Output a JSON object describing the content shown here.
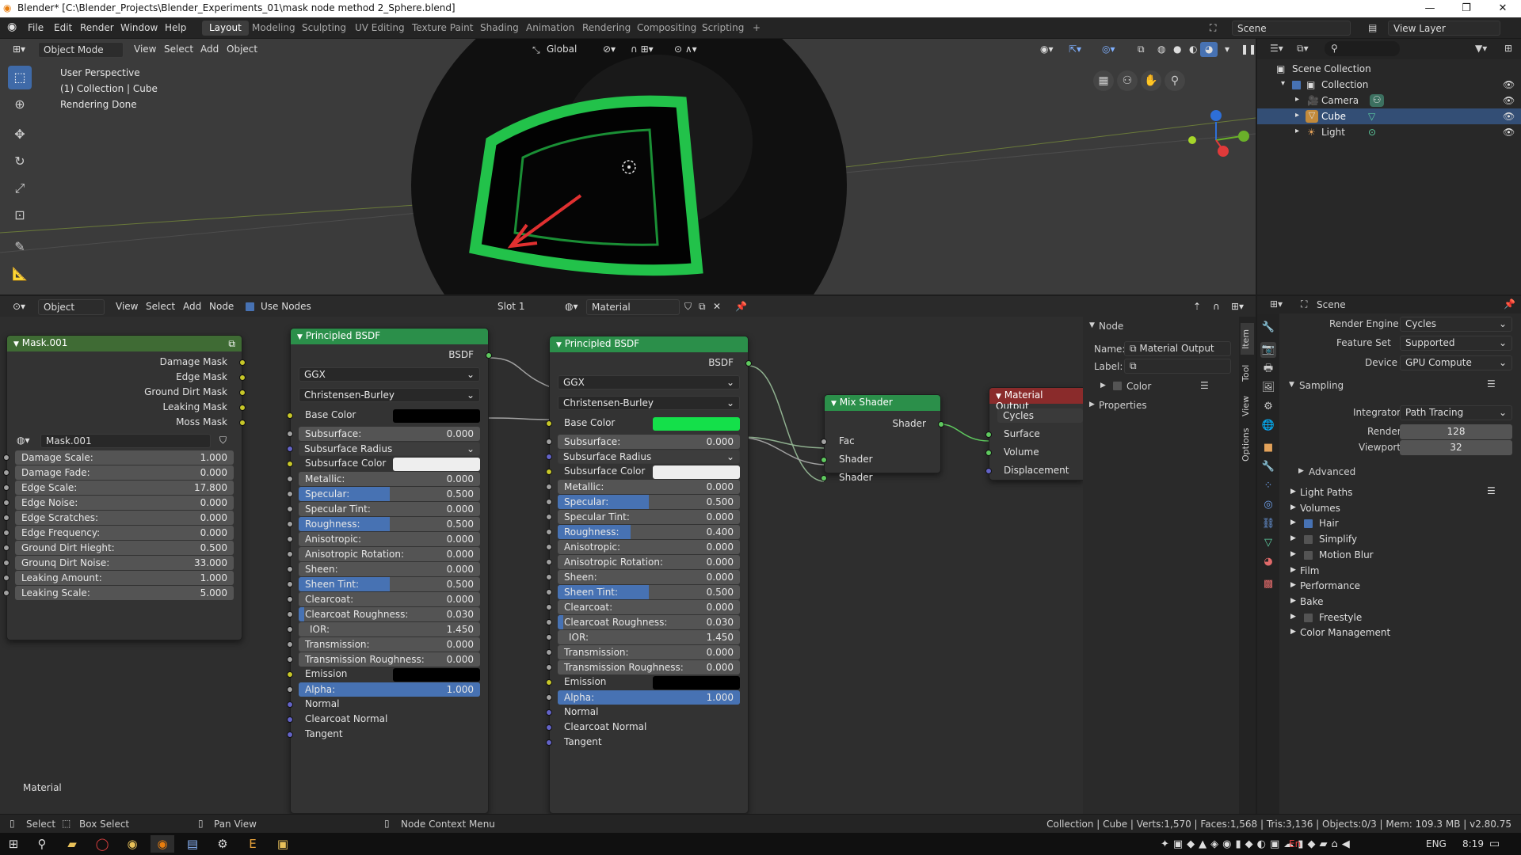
{
  "window": {
    "title": "Blender* [C:\\Blender_Projects\\Blender_Experiments_01\\mask node method 2_Sphere.blend]",
    "minimize": "—",
    "maximize": "❐",
    "close": "✕"
  },
  "topbar": {
    "menus": [
      "File",
      "Edit",
      "Render",
      "Window",
      "Help"
    ],
    "workspaces": [
      "Layout",
      "Modeling",
      "Sculpting",
      "UV Editing",
      "Texture Paint",
      "Shading",
      "Animation",
      "Rendering",
      "Compositing",
      "Scripting"
    ],
    "add_tab": "+",
    "scene": "Scene",
    "view_layer": "View Layer"
  },
  "viewport": {
    "mode": "Object Mode",
    "menus": [
      "View",
      "Select",
      "Add",
      "Object"
    ],
    "orientation": "Global",
    "info": [
      "User Perspective",
      "(1) Collection | Cube",
      "Rendering Done"
    ]
  },
  "outliner": {
    "root": "Scene Collection",
    "collection": "Collection",
    "items": [
      {
        "name": "Camera",
        "selected": false
      },
      {
        "name": "Cube",
        "selected": true
      },
      {
        "name": "Light",
        "selected": false
      }
    ]
  },
  "node_editor": {
    "type": "Object",
    "menus": [
      "View",
      "Select",
      "Add",
      "Node"
    ],
    "use_nodes": "Use Nodes",
    "slot": "Slot 1",
    "material": "Material",
    "footer_label": "Material"
  },
  "mask_node": {
    "title": "Mask.001",
    "outputs": [
      "Damage Mask",
      "Edge Mask",
      "Ground Dirt Mask",
      "Leaking Mask",
      "Moss Mask"
    ],
    "group_name": "Mask.001",
    "inputs": [
      {
        "label": "Damage Scale:",
        "value": "1.000"
      },
      {
        "label": "Damage Fade:",
        "value": "0.000"
      },
      {
        "label": "Edge Scale:",
        "value": "17.800"
      },
      {
        "label": "Edge Noise:",
        "value": "0.000"
      },
      {
        "label": "Edge Scratches:",
        "value": "0.000"
      },
      {
        "label": "Edge Frequency:",
        "value": "0.000"
      },
      {
        "label": "Ground Dirt Hieght:",
        "value": "0.500"
      },
      {
        "label": "Grounq Dirt Noise:",
        "value": "33.000"
      },
      {
        "label": "Leaking Amount:",
        "value": "1.000"
      },
      {
        "label": "Leaking Scale:",
        "value": "5.000"
      }
    ]
  },
  "bsdf1": {
    "title": "Principled BSDF",
    "output": "BSDF",
    "distribution": "GGX",
    "subsurface_method": "Christensen-Burley",
    "base_color_label": "Base Color",
    "base_color": "#000000",
    "rows": [
      {
        "label": "Subsurface:",
        "value": "0.000",
        "fill": 0
      },
      {
        "label": "Subsurface Radius",
        "dropdown": true
      },
      {
        "label": "Subsurface Color",
        "swatch": "#eeeeee"
      },
      {
        "label": "Metallic:",
        "value": "0.000",
        "fill": 0
      },
      {
        "label": "Specular:",
        "value": "0.500",
        "fill": 0.5
      },
      {
        "label": "Specular Tint:",
        "value": "0.000",
        "fill": 0
      },
      {
        "label": "Roughness:",
        "value": "0.500",
        "fill": 0.5
      },
      {
        "label": "Anisotropic:",
        "value": "0.000",
        "fill": 0
      },
      {
        "label": "Anisotropic Rotation:",
        "value": "0.000",
        "fill": 0
      },
      {
        "label": "Sheen:",
        "value": "0.000",
        "fill": 0
      },
      {
        "label": "Sheen Tint:",
        "value": "0.500",
        "fill": 0.5
      },
      {
        "label": "Clearcoat:",
        "value": "0.000",
        "fill": 0
      },
      {
        "label": "Clearcoat Roughness:",
        "value": "0.030",
        "fill": 0.03
      },
      {
        "label": "IOR:",
        "value": "1.450",
        "fill": 0
      },
      {
        "label": "Transmission:",
        "value": "0.000",
        "fill": 0
      },
      {
        "label": "Transmission Roughness:",
        "value": "0.000",
        "fill": 0
      },
      {
        "label": "Emission",
        "swatch": "#000000"
      },
      {
        "label": "Alpha:",
        "value": "1.000",
        "fill": 1
      },
      {
        "label": "Normal",
        "plain": true
      },
      {
        "label": "Clearcoat Normal",
        "plain": true
      },
      {
        "label": "Tangent",
        "plain": true
      }
    ]
  },
  "bsdf2": {
    "title": "Principled BSDF",
    "output": "BSDF",
    "distribution": "GGX",
    "subsurface_method": "Christensen-Burley",
    "base_color_label": "Base Color",
    "base_color": "#14e04a",
    "rows": [
      {
        "label": "Subsurface:",
        "value": "0.000",
        "fill": 0
      },
      {
        "label": "Subsurface Radius",
        "dropdown": true
      },
      {
        "label": "Subsurface Color",
        "swatch": "#eeeeee"
      },
      {
        "label": "Metallic:",
        "value": "0.000",
        "fill": 0
      },
      {
        "label": "Specular:",
        "value": "0.500",
        "fill": 0.5
      },
      {
        "label": "Specular Tint:",
        "value": "0.000",
        "fill": 0
      },
      {
        "label": "Roughness:",
        "value": "0.400",
        "fill": 0.4
      },
      {
        "label": "Anisotropic:",
        "value": "0.000",
        "fill": 0
      },
      {
        "label": "Anisotropic Rotation:",
        "value": "0.000",
        "fill": 0
      },
      {
        "label": "Sheen:",
        "value": "0.000",
        "fill": 0
      },
      {
        "label": "Sheen Tint:",
        "value": "0.500",
        "fill": 0.5
      },
      {
        "label": "Clearcoat:",
        "value": "0.000",
        "fill": 0
      },
      {
        "label": "Clearcoat Roughness:",
        "value": "0.030",
        "fill": 0.03
      },
      {
        "label": "IOR:",
        "value": "1.450",
        "fill": 0
      },
      {
        "label": "Transmission:",
        "value": "0.000",
        "fill": 0
      },
      {
        "label": "Transmission Roughness:",
        "value": "0.000",
        "fill": 0
      },
      {
        "label": "Emission",
        "swatch": "#000000"
      },
      {
        "label": "Alpha:",
        "value": "1.000",
        "fill": 1
      },
      {
        "label": "Normal",
        "plain": true
      },
      {
        "label": "Clearcoat Normal",
        "plain": true
      },
      {
        "label": "Tangent",
        "plain": true
      }
    ]
  },
  "mix_shader": {
    "title": "Mix Shader",
    "output": "Shader",
    "inputs": [
      "Fac",
      "Shader",
      "Shader"
    ]
  },
  "material_output": {
    "title": "Material Output",
    "target": "Cycles",
    "inputs": [
      "Surface",
      "Volume",
      "Displacement"
    ]
  },
  "npanel": {
    "section": "Node",
    "name_label": "Name:",
    "name_value": "Material Output",
    "label_label": "Label:",
    "color": "Color",
    "properties": "Properties",
    "tabs": [
      "Item",
      "Tool",
      "View",
      "Options"
    ]
  },
  "properties": {
    "scene": "Scene",
    "render_engine_label": "Render Engine",
    "render_engine": "Cycles",
    "feature_set_label": "Feature Set",
    "feature_set": "Supported",
    "device_label": "Device",
    "device": "GPU Compute",
    "sampling": "Sampling",
    "integrator_label": "Integrator",
    "integrator": "Path Tracing",
    "render_label": "Render",
    "render_samples": "128",
    "viewport_label": "Viewport",
    "viewport_samples": "32",
    "advanced": "Advanced",
    "panels": [
      {
        "label": "Light Paths",
        "checkbox": null
      },
      {
        "label": "Volumes",
        "checkbox": null
      },
      {
        "label": "Hair",
        "checkbox": true
      },
      {
        "label": "Simplify",
        "checkbox": false
      },
      {
        "label": "Motion Blur",
        "checkbox": false
      },
      {
        "label": "Film",
        "checkbox": null
      },
      {
        "label": "Performance",
        "checkbox": null
      },
      {
        "label": "Bake",
        "checkbox": null
      },
      {
        "label": "Freestyle",
        "checkbox": false
      },
      {
        "label": "Color Management",
        "checkbox": null
      }
    ]
  },
  "statusbar": {
    "select": "Select",
    "box_select": "Box Select",
    "pan_view": "Pan View",
    "context_menu": "Node Context Menu",
    "stats": "Collection | Cube | Verts:1,570 | Faces:1,568 | Tris:3,136 | Objects:0/3 | Mem: 109.3 MB | v2.80.75"
  },
  "taskbar": {
    "lang": "ENG",
    "time": "8:19",
    "lang2": "En"
  },
  "colors": {
    "accent": "#4772b3",
    "node_green": "#2b8f4a",
    "node_red": "#8a2b2b",
    "socket_yellow": "#c7c729",
    "socket_green": "#5fc95f",
    "socket_purple": "#6363c7"
  }
}
